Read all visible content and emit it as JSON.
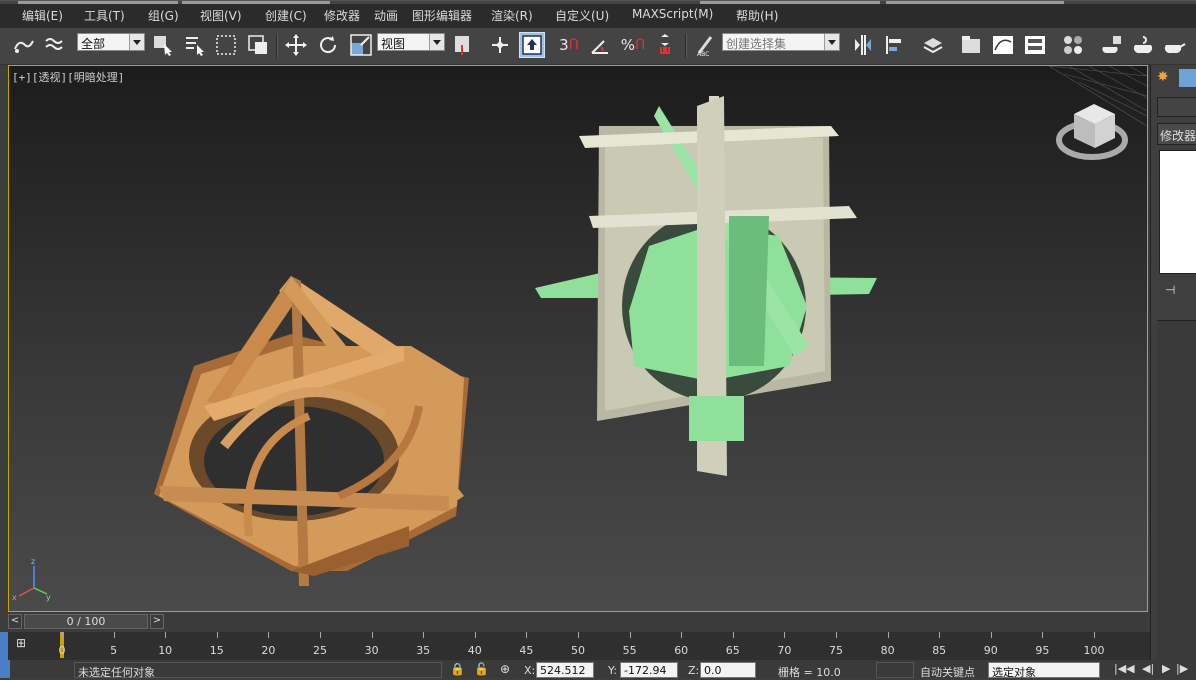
{
  "menu": [
    "编辑(E)",
    "工具(T)",
    "组(G)",
    "视图(V)",
    "创建(C)",
    "修改器",
    "动画",
    "图形编辑器",
    "渲染(R)",
    "自定义(U)",
    "MAXScript(M)",
    "帮助(H)"
  ],
  "toolbar": {
    "filter_select": "全部",
    "coord_select": "视图",
    "snap_label": "3",
    "percent_label": "%",
    "selection_set_placeholder": "创建选择集"
  },
  "viewport": {
    "label": "[+][透视][明暗处理]",
    "axis": {
      "x": "x",
      "y": "y",
      "z": "z"
    }
  },
  "right_panel": {
    "modifier_label": "修改器"
  },
  "timeline": {
    "frame_counter": "0 / 100",
    "ticks": [
      "0",
      "5",
      "10",
      "15",
      "20",
      "25",
      "30",
      "35",
      "40",
      "45",
      "50",
      "55",
      "60",
      "65",
      "70",
      "75",
      "80",
      "85",
      "90",
      "95",
      "100"
    ]
  },
  "status": {
    "message": "未选定任何对象",
    "x_label": "X:",
    "x_value": "524.512",
    "y_label": "Y:",
    "y_value": "-172.94",
    "z_label": "Z:",
    "z_value": "0.0",
    "grid_label": "栅格 = 10.0",
    "auto_key": "自动关键点",
    "selected_object": "选定对象"
  },
  "colors": {
    "accent": "#c9a300",
    "orange_object": "#d39a5a",
    "green_object": "#8fe09a",
    "beige_object": "#c9c9b4"
  }
}
